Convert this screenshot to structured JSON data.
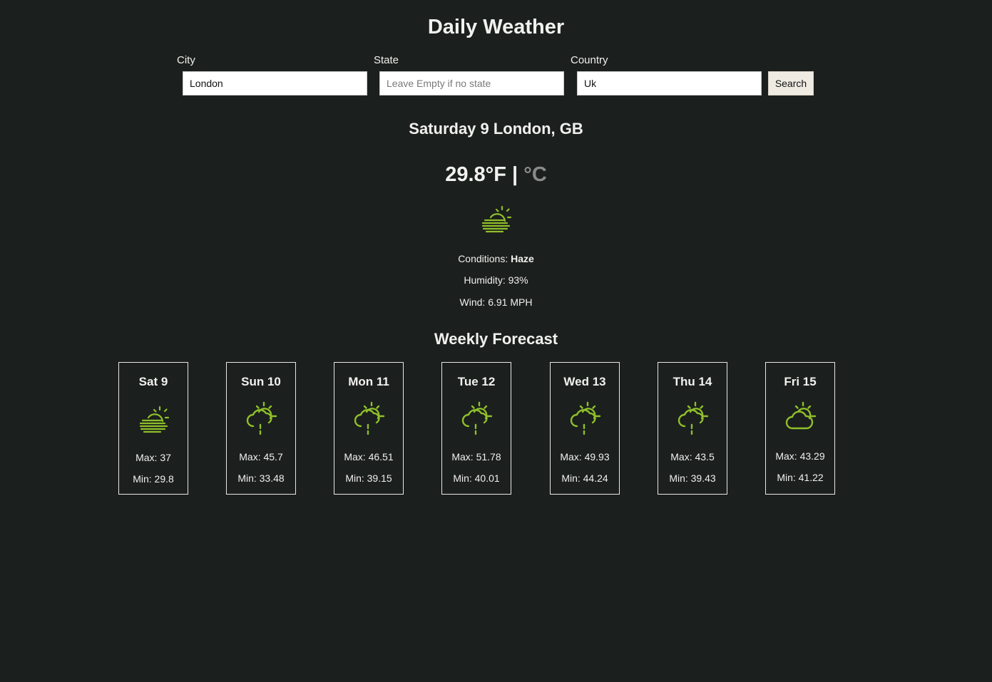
{
  "header": {
    "title": "Daily Weather"
  },
  "search": {
    "city_label": "City",
    "city_value": "London",
    "state_label": "State",
    "state_value": "",
    "state_placeholder": "Leave Empty if no state",
    "country_label": "Country",
    "country_value": "Uk",
    "search_button": "Search"
  },
  "current": {
    "heading": "Saturday 9 London, GB",
    "temperature": "29.8°F",
    "separator": "|",
    "alt_unit": "°C",
    "icon": "haze-icon",
    "conditions_label": "Conditions: ",
    "conditions_value": "Haze",
    "humidity": "Humidity: 93%",
    "wind": "Wind: 6.91 MPH"
  },
  "forecast": {
    "heading": "Weekly Forecast",
    "days": [
      {
        "day": "Sat 9",
        "icon": "haze-icon",
        "max": "Max: 37",
        "min": "Min: 29.8"
      },
      {
        "day": "Sun 10",
        "icon": "cloud-sun-rain-icon",
        "max": "Max: 45.7",
        "min": "Min: 33.48"
      },
      {
        "day": "Mon 11",
        "icon": "cloud-sun-rain-icon",
        "max": "Max: 46.51",
        "min": "Min: 39.15"
      },
      {
        "day": "Tue 12",
        "icon": "cloud-sun-rain-icon",
        "max": "Max: 51.78",
        "min": "Min: 40.01"
      },
      {
        "day": "Wed 13",
        "icon": "cloud-sun-rain-icon",
        "max": "Max: 49.93",
        "min": "Min: 44.24"
      },
      {
        "day": "Thu 14",
        "icon": "cloud-sun-rain-icon",
        "max": "Max: 43.5",
        "min": "Min: 39.43"
      },
      {
        "day": "Fri 15",
        "icon": "cloud-sun-icon",
        "max": "Max: 43.29",
        "min": "Min: 41.22"
      }
    ]
  },
  "colors": {
    "background": "#1b1f1d",
    "text": "#f1f1ef",
    "icon": "#8fbf2a",
    "muted_unit": "#8a8a8a",
    "button": "#efebe2"
  }
}
